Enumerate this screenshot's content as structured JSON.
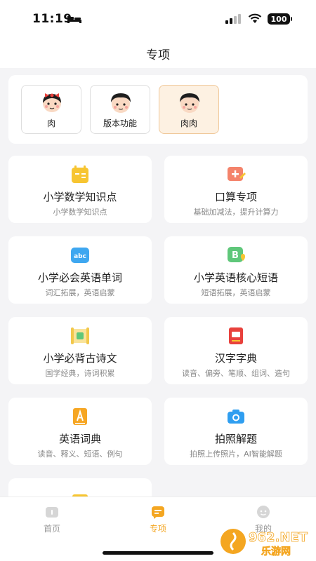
{
  "status_bar": {
    "time": "11:19",
    "battery": "100"
  },
  "header": {
    "title": "专项"
  },
  "characters": [
    {
      "label": "肉",
      "selected": false
    },
    {
      "label": "版本功能",
      "selected": false
    },
    {
      "label": "肉肉",
      "selected": true
    }
  ],
  "features": [
    {
      "title": "小学数学知识点",
      "subtitle": "小学数学知识点",
      "icon": "calculator-icon",
      "color": "#f7c531"
    },
    {
      "title": "口算专项",
      "subtitle": "基础加减法，提升计算力",
      "icon": "math-card-icon",
      "color": "#f4836b"
    },
    {
      "title": "小学必会英语单词",
      "subtitle": "词汇拓展，英语启蒙",
      "icon": "abc-icon",
      "color": "#3ea7f0"
    },
    {
      "title": "小学英语核心短语",
      "subtitle": "短语拓展，英语启蒙",
      "icon": "b-badge-icon",
      "color": "#5fc77a"
    },
    {
      "title": "小学必背古诗文",
      "subtitle": "国学经典，诗词积累",
      "icon": "scroll-icon",
      "color": "#f2c84b"
    },
    {
      "title": "汉字字典",
      "subtitle": "读音、偏旁、笔顺、组词、造句",
      "icon": "dictionary-icon",
      "color": "#e8413c"
    },
    {
      "title": "英语词典",
      "subtitle": "读音、释义、短语、例句",
      "icon": "english-dict-icon",
      "color": "#f6a623"
    },
    {
      "title": "拍照解题",
      "subtitle": "拍照上传照片，AI智能解题",
      "icon": "camera-icon",
      "color": "#2f9ef0"
    }
  ],
  "tabs": [
    {
      "label": "首页",
      "icon": "home-icon",
      "active": false
    },
    {
      "label": "专项",
      "icon": "special-icon",
      "active": true
    },
    {
      "label": "我的",
      "icon": "profile-icon",
      "active": false
    }
  ],
  "watermark": {
    "text": "962.NET",
    "subtext": "乐游网"
  },
  "colors": {
    "accent": "#f4a621",
    "background": "#f4f4f6",
    "selected_bg": "#fdf1e2"
  }
}
